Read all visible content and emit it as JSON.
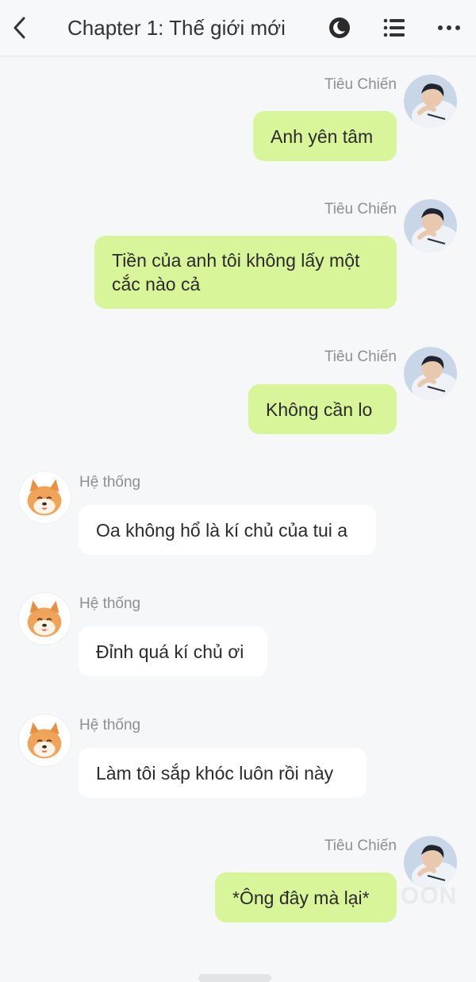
{
  "header": {
    "title": "Chapter 1: Thế giới mới",
    "back_icon": "back-arrow-icon",
    "theme_icon": "night-mode-icon",
    "list_icon": "chapter-list-icon",
    "more_icon": "more-dots-icon"
  },
  "colors": {
    "my_bubble": "#d9f59a",
    "system_bubble": "#ffffff",
    "background": "#f6f7f9"
  },
  "messages": [
    {
      "sender": "Tiêu Chiến",
      "text": "Anh yên tâm"
    },
    {
      "sender": "Tiêu Chiến",
      "text": "Tiền của anh tôi không lấy một cắc nào cả"
    },
    {
      "sender": "Tiêu Chiến",
      "text": "Không cần lo"
    },
    {
      "sender": "Hệ thống",
      "text": "Oa không hổ là kí chủ của tui a"
    },
    {
      "sender": "Hệ thống",
      "text": "Đỉnh quá kí chủ ơi"
    },
    {
      "sender": "Hệ thống",
      "text": "Làm tôi sắp khóc luôn rồi này"
    },
    {
      "sender": "Tiêu Chiến",
      "text": "*Ông đây mà lại*"
    }
  ],
  "watermark": "OON"
}
